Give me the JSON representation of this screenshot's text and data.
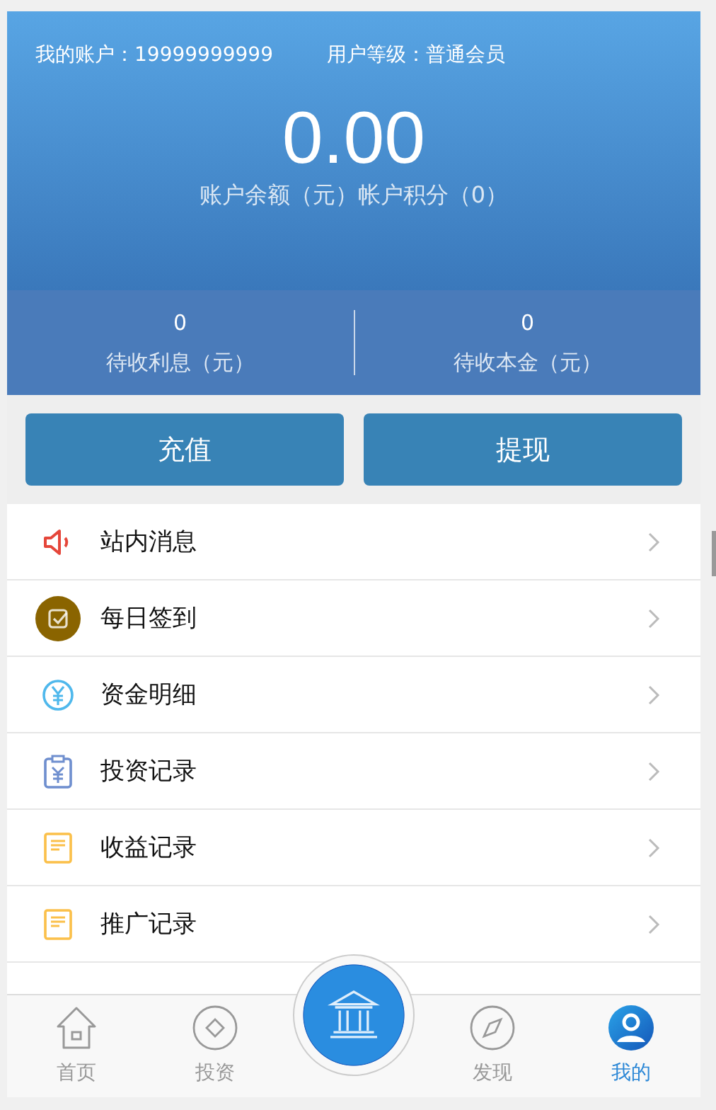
{
  "header": {
    "account_label": "我的账户：19999999999",
    "level_label": "用户等级：普通会员",
    "balance": "0.00",
    "balance_caption": "账户余额（元）帐户积分（0）"
  },
  "stats": [
    {
      "value": "0",
      "label": "待收利息（元）"
    },
    {
      "value": "0",
      "label": "待收本金（元）"
    }
  ],
  "buttons": [
    "充值",
    "提现"
  ],
  "menu": [
    {
      "kind": "speaker",
      "label": "站内消息"
    },
    {
      "kind": "checkin",
      "label": "每日签到"
    },
    {
      "kind": "yuan",
      "label": "资金明细"
    },
    {
      "kind": "clipboard",
      "label": "投资记录"
    },
    {
      "kind": "note",
      "label": "收益记录"
    },
    {
      "kind": "note",
      "label": "推广记录"
    }
  ],
  "tabs": [
    {
      "kind": "home",
      "label": "首页",
      "selected": false
    },
    {
      "kind": "diamond",
      "label": "投资",
      "selected": false
    },
    {
      "kind": "bank",
      "selected": false
    },
    {
      "kind": "compass",
      "label": "发现",
      "selected": false
    },
    {
      "kind": "user",
      "label": "我的",
      "selected": true
    }
  ]
}
